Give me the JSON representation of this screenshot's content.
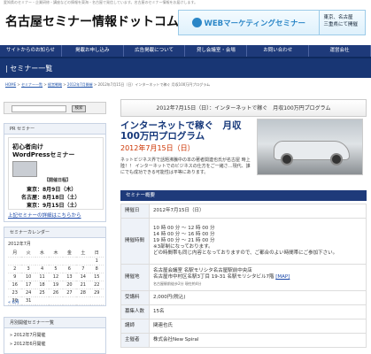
{
  "header": {
    "tagline": "愛知県のセミナー・企業研修・講座などの情報を東海・名古屋で発信しています。名古屋のセミナー情報をお届けします。",
    "logo": "名古屋セミナー情報ドットコム",
    "banner_title": "WEBマーケティングセミナー",
    "banner_loc1": "東京、名古屋",
    "banner_loc2": "三重県にて開催"
  },
  "nav": [
    "サイトからのお知らせ",
    "掲載お申し込み",
    "広告掲載について",
    "貸し会議室・会場",
    "お問い合わせ",
    "運営会社"
  ],
  "section_title": "| セミナー一覧",
  "breadcrumb": {
    "home": "HOME",
    "sep": ">",
    "b1": "セミナー一覧",
    "b2": "経営戦略",
    "b3": "2012年7月開催",
    "current": "2012年7月15日（日）インターネットで稼ぐ 月収100万円プログラム"
  },
  "sidebar": {
    "search_placeholder": "",
    "search_button": "検索",
    "pr_heading": "PR セミナー",
    "pr_title_1": "初心者向け",
    "pr_title_2": "WordPressセミナー",
    "pr_schedule_heading": "【開催日程】",
    "pr_dates": [
      "東京：8月9日（木）",
      "名古屋：8月18日（土）",
      "東京：9月15日（土）"
    ],
    "pr_link": "上記セミナーの詳細はこちらから",
    "calendar_heading": "セミナーカレンダー",
    "calendar_month": "2012年7月",
    "calendar_weekdays": [
      "月",
      "火",
      "水",
      "木",
      "金",
      "土",
      "日"
    ],
    "calendar_rows": [
      [
        "",
        "",
        "",
        "",
        "",
        "",
        "1"
      ],
      [
        "2",
        "3",
        "4",
        "5",
        "6",
        "7",
        "8"
      ],
      [
        "9",
        "10",
        "11",
        "12",
        "13",
        "14",
        "15"
      ],
      [
        "16",
        "17",
        "18",
        "19",
        "20",
        "21",
        "22"
      ],
      [
        "23",
        "24",
        "25",
        "26",
        "27",
        "28",
        "29"
      ],
      [
        "30",
        "31",
        "",
        "",
        "",
        "",
        ""
      ]
    ],
    "calendar_prev": "« 6月",
    "related_heading": "月別開催セミナー一覧",
    "related_items": [
      "» 2012年7月開催",
      "» 2012年6月開催"
    ]
  },
  "main": {
    "heading": "2012年7月15日（日）：インターネットで稼ぐ　月収100万円プログラム",
    "title": "インターネットで稼ぐ　月収100万円プログラム",
    "date": "2012年7月15日（日）",
    "description": "ネットビジネス界で話題沸騰中の本の著者関連也氏が名古屋 時上陸！！ インターネットでのビジネスの仕方をご一緒さ…現代、誰にでも成功できる可能性は平等にあります。",
    "overview_heading": "セミナー概要",
    "rows": [
      {
        "k": "開催日",
        "v": "2012年7月15日（日）"
      },
      {
        "k": "開催時間",
        "v": "10 時 00 分 〜 12 時 00 分\n14 時 00 分 〜 16 時 00 分\n19 時 00 分 〜 21 時 00 分\n※3部制になっております。\nどの時間帯も同じ内容となっておりますので、ご都合のよい時間帯にご参加下さい。"
      },
      {
        "k": "開催地",
        "v": "名古屋会議室 名駅モリシタ名古屋駅前中央店\n名古屋市中村区名駅3丁目 19-31 名駅モリシタビル7階 ",
        "map": "[MAP]",
        "note": "名古屋駅前徒歩2分 現在約4分"
      },
      {
        "k": "受講料",
        "v": "2,000円(税込)"
      },
      {
        "k": "募集人数",
        "v": "15名"
      },
      {
        "k": "講師",
        "v": "関連也氏"
      },
      {
        "k": "主催者",
        "v": "株式会社New Spiral"
      }
    ]
  },
  "colors": {
    "nav_bg": "#1e3a7a",
    "title": "#16387a",
    "date": "#cc3300",
    "link": "#1a47a8"
  }
}
